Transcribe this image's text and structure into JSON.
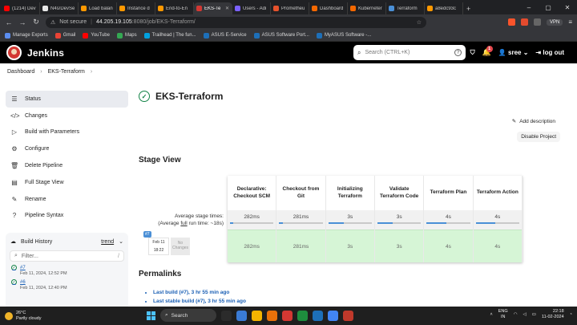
{
  "browser": {
    "tabs": [
      {
        "title": "(1214) Dev",
        "color": "#ff0000",
        "active": false
      },
      {
        "title": "N4s/DevSe",
        "color": "#e8e8e8",
        "active": false
      },
      {
        "title": "Load balan",
        "color": "#ff9900",
        "active": false
      },
      {
        "title": "Instance d",
        "color": "#ff9900",
        "active": false
      },
      {
        "title": "End-to-En",
        "color": "#ff9900",
        "active": false
      },
      {
        "title": "EKS-Te",
        "color": "#d33833",
        "active": true
      },
      {
        "title": "Users - Adi",
        "color": "#7b61ff",
        "active": false
      },
      {
        "title": "Prometheu",
        "color": "#e6522c",
        "active": false
      },
      {
        "title": "Dashboard",
        "color": "#f46800",
        "active": false
      },
      {
        "title": "Kuberneter",
        "color": "#f46800",
        "active": false
      },
      {
        "title": "Terraform",
        "color": "#4a8fd6",
        "active": false
      },
      {
        "title": "a8edc93c",
        "color": "#ff9900",
        "active": false
      }
    ],
    "address": {
      "security": "Not secure",
      "host": "44.205.19.105",
      "path": ":8080/job/EKS-Terraform/"
    },
    "vpn_label": "VPN",
    "bookmarks": [
      {
        "label": "Manage Exports",
        "color": "#5b8def"
      },
      {
        "label": "Gmail",
        "color": "#ea4335"
      },
      {
        "label": "YouTube",
        "color": "#ff0000"
      },
      {
        "label": "Maps",
        "color": "#34a853"
      },
      {
        "label": "Trailhead | The fun...",
        "color": "#00a1e0"
      },
      {
        "label": "ASUS E-Service",
        "color": "#1d6fb8"
      },
      {
        "label": "ASUS Software Port...",
        "color": "#1d6fb8"
      },
      {
        "label": "MyASUS Software -...",
        "color": "#1d6fb8"
      }
    ]
  },
  "jenkins": {
    "brand": "Jenkins",
    "search_placeholder": "Search (CTRL+K)",
    "notifications": "1",
    "user": "sree",
    "logout": "log out"
  },
  "breadcrumb": [
    "Dashboard",
    "EKS-Terraform"
  ],
  "sidebar": {
    "items": [
      {
        "label": "Status",
        "icon": "status-icon",
        "glyph": "☰",
        "active": true
      },
      {
        "label": "Changes",
        "icon": "changes-icon",
        "glyph": "</>",
        "active": false
      },
      {
        "label": "Build with Parameters",
        "icon": "build-icon",
        "glyph": "▷",
        "active": false
      },
      {
        "label": "Configure",
        "icon": "gear-icon",
        "glyph": "⚙",
        "active": false
      },
      {
        "label": "Delete Pipeline",
        "icon": "trash-icon",
        "glyph": "🗑",
        "active": false
      },
      {
        "label": "Full Stage View",
        "icon": "stage-view-icon",
        "glyph": "▤",
        "active": false
      },
      {
        "label": "Rename",
        "icon": "rename-icon",
        "glyph": "✎",
        "active": false
      },
      {
        "label": "Pipeline Syntax",
        "icon": "help-icon",
        "glyph": "?",
        "active": false
      }
    ]
  },
  "build_history": {
    "title": "Build History",
    "trend": "trend",
    "filter_placeholder": "Filter...",
    "filter_shortcut": "/",
    "builds": [
      {
        "number": "#7",
        "date": "Feb 11, 2024, 12:52 PM"
      },
      {
        "number": "#6",
        "date": "Feb 11, 2024, 12:40 PM"
      }
    ]
  },
  "main": {
    "title": "EKS-Terraform",
    "add_description": "Add description",
    "disable_project": "Disable Project",
    "stage_view_title": "Stage View",
    "avg_stage_times": "Average stage times:",
    "avg_full_run_prefix": "(Average ",
    "avg_full_run_link": "full",
    "avg_full_run_suffix": " run time: ~18s)",
    "stages": [
      {
        "name": "Declarative: Checkout SCM",
        "avg": "282ms",
        "avg_fraction": 0.08,
        "run": "282ms"
      },
      {
        "name": "Checkout from Git",
        "avg": "281ms",
        "avg_fraction": 0.08,
        "run": "281ms"
      },
      {
        "name": "Initializing Terraform",
        "avg": "3s",
        "avg_fraction": 0.35,
        "run": "3s"
      },
      {
        "name": "Validate Terraform Code",
        "avg": "3s",
        "avg_fraction": 0.35,
        "run": "3s"
      },
      {
        "name": "Terraform Plan",
        "avg": "4s",
        "avg_fraction": 0.45,
        "run": "4s"
      },
      {
        "name": "Terraform Action",
        "avg": "4s",
        "avg_fraction": 0.45,
        "run": "4s"
      }
    ],
    "run": {
      "number": "#7",
      "date": "Feb 11",
      "time": "18:22",
      "changes": "No Changes"
    },
    "permalinks_title": "Permalinks",
    "permalinks": [
      "Last build (#7), 3 hr 55 min ago",
      "Last stable build (#7), 3 hr 55 min ago"
    ]
  },
  "taskbar": {
    "temperature": "26°C",
    "weather": "Partly cloudy",
    "search": "Search",
    "lang1": "ENG",
    "lang2": "IN",
    "time": "22:18",
    "date": "11-02-2024",
    "apps": [
      "#2b2b2b",
      "#3a7bd5",
      "#f4b400",
      "#e8710a",
      "#d33833",
      "#1e8e3e",
      "#1d6fb8",
      "#4285f4",
      "#c0392b"
    ]
  },
  "colors": {
    "jenkins_header": "#000000",
    "success_green": "#138347",
    "stage_cell": "#d6f5d6",
    "link": "#1a5fb4"
  }
}
